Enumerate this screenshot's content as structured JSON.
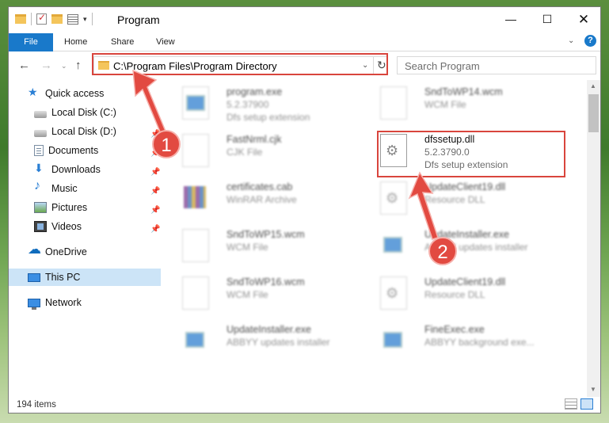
{
  "window": {
    "title": "Program",
    "controls": {
      "minimize": "—",
      "maximize": "☐",
      "close": "✕"
    }
  },
  "ribbon": {
    "tabs": [
      "File",
      "Home",
      "Share",
      "View"
    ],
    "expand": "⌄",
    "help": "?"
  },
  "nav": {
    "back": "←",
    "forward": "→",
    "recent": "⌄",
    "up": "↑",
    "address": "C:\\Program Files\\Program Directory",
    "address_dropdown": "⌄",
    "refresh": "↻",
    "search_placeholder": "Search Program"
  },
  "sidebar": {
    "items": [
      {
        "label": "Quick access",
        "icon": "star-icon",
        "pinned": false
      },
      {
        "label": "Local Disk (C:)",
        "icon": "disk-icon",
        "pinned": true
      },
      {
        "label": "Local Disk (D:)",
        "icon": "disk-icon",
        "pinned": true
      },
      {
        "label": "Documents",
        "icon": "documents-icon",
        "pinned": true
      },
      {
        "label": "Downloads",
        "icon": "downloads-icon",
        "pinned": true
      },
      {
        "label": "Music",
        "icon": "music-icon",
        "pinned": true
      },
      {
        "label": "Pictures",
        "icon": "pictures-icon",
        "pinned": true
      },
      {
        "label": "Videos",
        "icon": "videos-icon",
        "pinned": true
      },
      {
        "label": "OneDrive",
        "icon": "onedrive-icon",
        "pinned": false
      },
      {
        "label": "This PC",
        "icon": "pc-icon",
        "pinned": false,
        "selected": true
      },
      {
        "label": "Network",
        "icon": "network-icon",
        "pinned": false
      }
    ],
    "pin_glyph": "📌"
  },
  "files": [
    {
      "name": "program.exe",
      "line1": "5.2.37900",
      "line2": "Dfs setup extension",
      "icon": "exe-icon",
      "blurred": true
    },
    {
      "name": "SndToWP14.wcm",
      "line1": "WCM File",
      "line2": "",
      "icon": "file-icon",
      "blurred": true
    },
    {
      "name": "FastNrml.cjk",
      "line1": "CJK File",
      "line2": "",
      "icon": "file-icon",
      "blurred": true
    },
    {
      "name": "dfssetup.dll",
      "line1": "5.2.3790.0",
      "line2": "Dfs setup extension",
      "icon": "dll-gear-icon",
      "blurred": false,
      "highlighted": true
    },
    {
      "name": "certificates.cab",
      "line1": "WinRAR Archive",
      "line2": "",
      "icon": "winrar-icon",
      "blurred": true
    },
    {
      "name": "UpdateClient19.dll",
      "line1": "Resource DLL",
      "line2": "",
      "icon": "dll-gear-icon",
      "blurred": true
    },
    {
      "name": "SndToWP15.wcm",
      "line1": "WCM File",
      "line2": "",
      "icon": "file-icon",
      "blurred": true
    },
    {
      "name": "UpdateInstaller.exe",
      "line1": "ABBYY updates installer",
      "line2": "",
      "icon": "exe-icon",
      "blurred": true
    },
    {
      "name": "SndToWP16.wcm",
      "line1": "WCM File",
      "line2": "",
      "icon": "file-icon",
      "blurred": true
    },
    {
      "name": "UpdateClient19.dll",
      "line1": "Resource DLL",
      "line2": "",
      "icon": "dll-gear-icon",
      "blurred": true
    },
    {
      "name": "UpdateInstaller.exe",
      "line1": "ABBYY updates installer",
      "line2": "",
      "icon": "exe-icon",
      "blurred": true
    },
    {
      "name": "FineExec.exe",
      "line1": "ABBYY background exe...",
      "line2": "",
      "icon": "exe-icon",
      "blurred": true
    }
  ],
  "status": {
    "items": "194 items"
  },
  "annotations": {
    "step1": "1",
    "step2": "2",
    "color": "#d9453d"
  }
}
